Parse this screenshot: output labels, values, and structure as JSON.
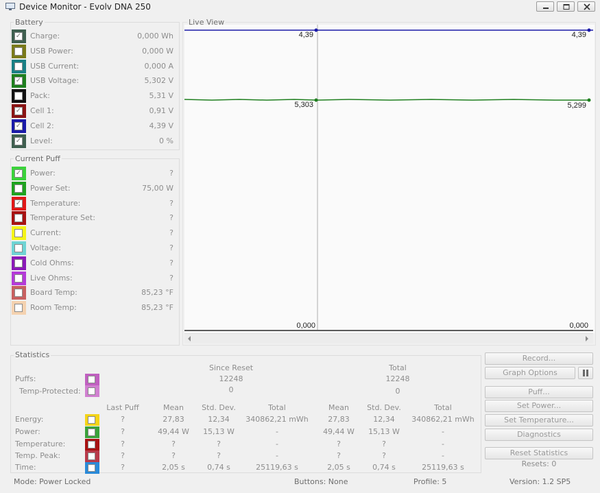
{
  "window": {
    "title": "Device Monitor - Evolv DNA 250"
  },
  "battery": {
    "title": "Battery",
    "rows": [
      {
        "label": "Charge:",
        "value": "0,000 Wh",
        "color": "#3f5f4f",
        "checked": true
      },
      {
        "label": "USB Power:",
        "value": "0,000 W",
        "color": "#7a7a1a",
        "checked": false
      },
      {
        "label": "USB Current:",
        "value": "0,000 A",
        "color": "#1a7f84",
        "checked": false
      },
      {
        "label": "USB Voltage:",
        "value": "5,302 V",
        "color": "#1f7f1f",
        "checked": true
      },
      {
        "label": "Pack:",
        "value": "5,31 V",
        "color": "#111111",
        "checked": false
      },
      {
        "label": "Cell 1:",
        "value": "0,91 V",
        "color": "#8a1414",
        "checked": true
      },
      {
        "label": "Cell 2:",
        "value": "4,39 V",
        "color": "#1a1aa8",
        "checked": true
      },
      {
        "label": "Level:",
        "value": "0 %",
        "color": "#3f5f4f",
        "checked": true
      }
    ]
  },
  "puff": {
    "title": "Current Puff",
    "rows": [
      {
        "label": "Power:",
        "value": "?",
        "color": "#3bd23b",
        "checked": true
      },
      {
        "label": "Power Set:",
        "value": "75,00 W",
        "color": "#1fa21f",
        "checked": false
      },
      {
        "label": "Temperature:",
        "value": "?",
        "color": "#e01818",
        "checked": true
      },
      {
        "label": "Temperature Set:",
        "value": "?",
        "color": "#a81212",
        "checked": false
      },
      {
        "label": "Current:",
        "value": "?",
        "color": "#f4f418",
        "checked": false
      },
      {
        "label": "Voltage:",
        "value": "?",
        "color": "#6fd4d4",
        "checked": false
      },
      {
        "label": "Cold Ohms:",
        "value": "?",
        "color": "#8a1ab8",
        "checked": false
      },
      {
        "label": "Live Ohms:",
        "value": "?",
        "color": "#b43ad8",
        "checked": false
      },
      {
        "label": "Board Temp:",
        "value": "85,23 °F",
        "color": "#c86060",
        "checked": false
      },
      {
        "label": "Room Temp:",
        "value": "85,23 °F",
        "color": "#f4d2b0",
        "checked": false
      }
    ]
  },
  "live_view": {
    "title": "Live View",
    "top_left": "4,39",
    "top_right": "4,39",
    "mid_left": "5,303",
    "mid_right": "5,299",
    "bottom_left": "0,000",
    "bottom_right": "0,000",
    "line_top_color": "#1a1aa8",
    "line_mid_color": "#1f7f1f"
  },
  "statistics": {
    "title": "Statistics",
    "since_reset_label": "Since Reset",
    "since_reset_puffs": "12248",
    "since_reset_temp": "0",
    "total_label": "Total",
    "total_puffs": "12248",
    "total_temp": "0",
    "puffs_label": "Puffs:",
    "temp_protected_label": "Temp-Protected:",
    "headers": [
      "Last Puff",
      "Mean",
      "Std. Dev.",
      "Total",
      "Mean",
      "Std. Dev.",
      "Total"
    ],
    "rows": [
      {
        "label": "Energy:",
        "color": "#f4d418",
        "values": [
          "?",
          "27,83",
          "12,34",
          "340862,21 mWh",
          "27,83",
          "12,34",
          "340862,21 mWh"
        ]
      },
      {
        "label": "Power:",
        "color": "#3aa23a",
        "values": [
          "?",
          "49,44 W",
          "15,13 W",
          "-",
          "49,44 W",
          "15,13 W",
          "-"
        ]
      },
      {
        "label": "Temperature:",
        "color": "#a81212",
        "values": [
          "?",
          "?",
          "?",
          "-",
          "?",
          "?",
          "-"
        ]
      },
      {
        "label": "Temp. Peak:",
        "color": "#b83a4a",
        "values": [
          "?",
          "?",
          "?",
          "-",
          "?",
          "?",
          "-"
        ]
      },
      {
        "label": "Time:",
        "color": "#2a8ad8",
        "values": [
          "?",
          "2,05 s",
          "0,74 s",
          "25119,63 s",
          "2,05 s",
          "0,74 s",
          "25119,63 s"
        ]
      }
    ]
  },
  "buttons": {
    "record": "Record...",
    "graph_options": "Graph Options",
    "puff": "Puff...",
    "set_power": "Set Power...",
    "set_temperature": "Set Temperature...",
    "diagnostics": "Diagnostics",
    "reset_statistics": "Reset Statistics",
    "resets": "Resets: 0"
  },
  "status": {
    "mode": "Mode: Power Locked",
    "buttons": "Buttons: None",
    "profile": "Profile: 5",
    "version": "Version: 1.2 SP5"
  }
}
